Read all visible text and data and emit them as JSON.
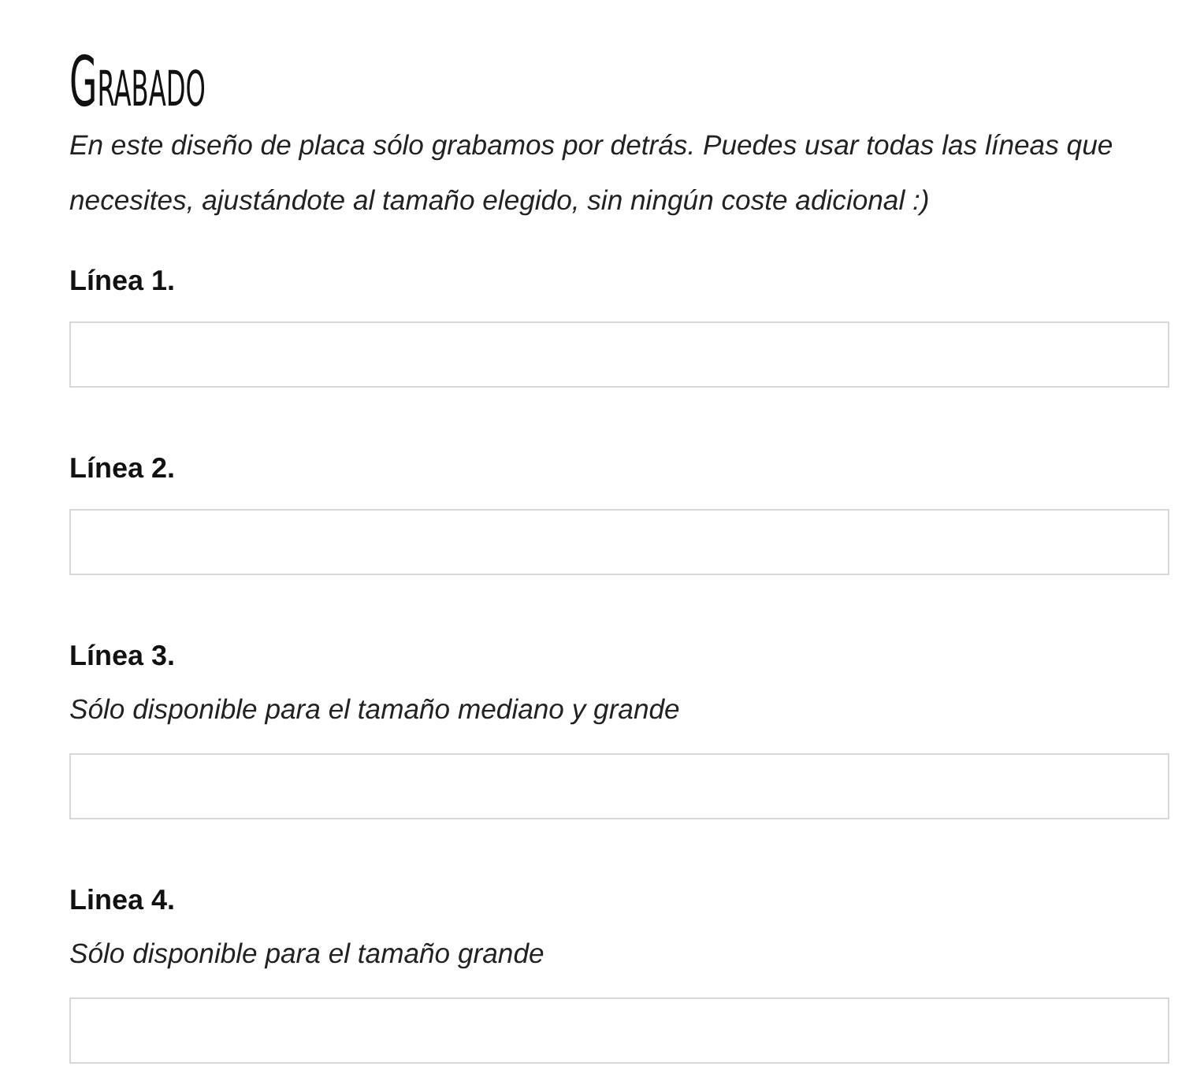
{
  "section": {
    "title": "Grabado",
    "description": "En este diseño de placa sólo grabamos por detrás. Puedes usar todas las líneas que necesites, ajustándote al tamaño elegido, sin ningún coste adicional :)"
  },
  "fields": [
    {
      "label": "Línea 1."
    },
    {
      "label": "Línea 2."
    },
    {
      "label": "Línea 3.",
      "note": "Sólo disponible para el tamaño mediano y grande"
    },
    {
      "label": "Linea 4.",
      "note": "Sólo disponible para el tamaño grande"
    }
  ]
}
